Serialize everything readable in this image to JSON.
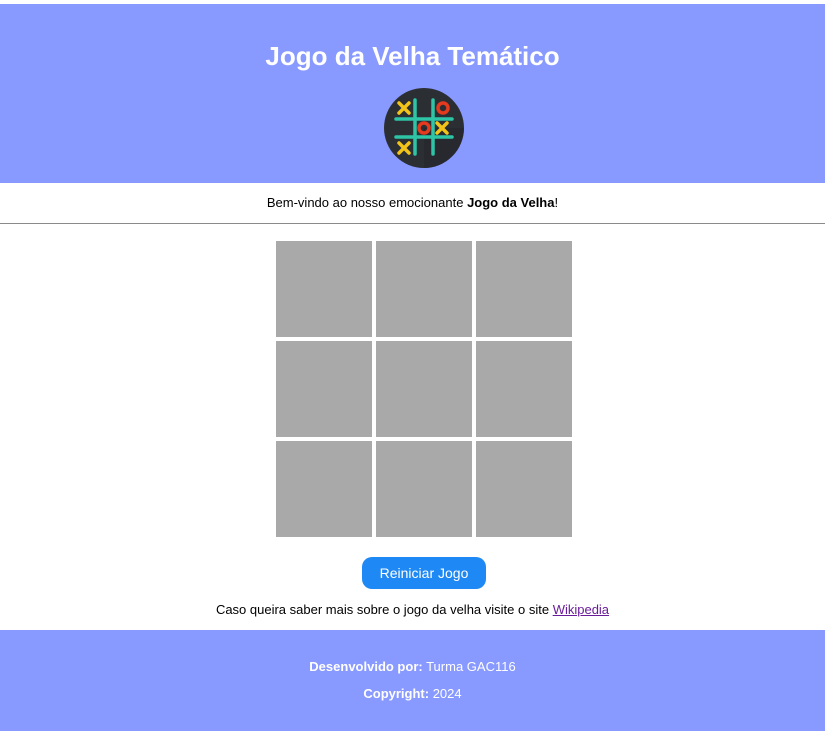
{
  "header": {
    "title": "Jogo da Velha Temático",
    "logo_icon": "tic-tac-toe-logo",
    "background": "#8899ff"
  },
  "welcome": {
    "prefix": "Bem-vindo ao nosso emocionante ",
    "strong": "Jogo da Velha",
    "suffix": "!"
  },
  "board": {
    "cells": [
      "",
      "",
      "",
      "",
      "",
      "",
      "",
      "",
      ""
    ],
    "cell_color": "#a9a9a9"
  },
  "controls": {
    "restart_label": "Reiniciar Jogo",
    "accent": "#1e88f5"
  },
  "info": {
    "text": "Caso queira saber mais sobre o jogo da velha visite o site ",
    "link_label": "Wikipedia"
  },
  "footer": {
    "dev_label": "Desenvolvido por:",
    "dev_value": " Turma GAC116",
    "copyright_label": "Copyright:",
    "copyright_value": " 2024"
  }
}
